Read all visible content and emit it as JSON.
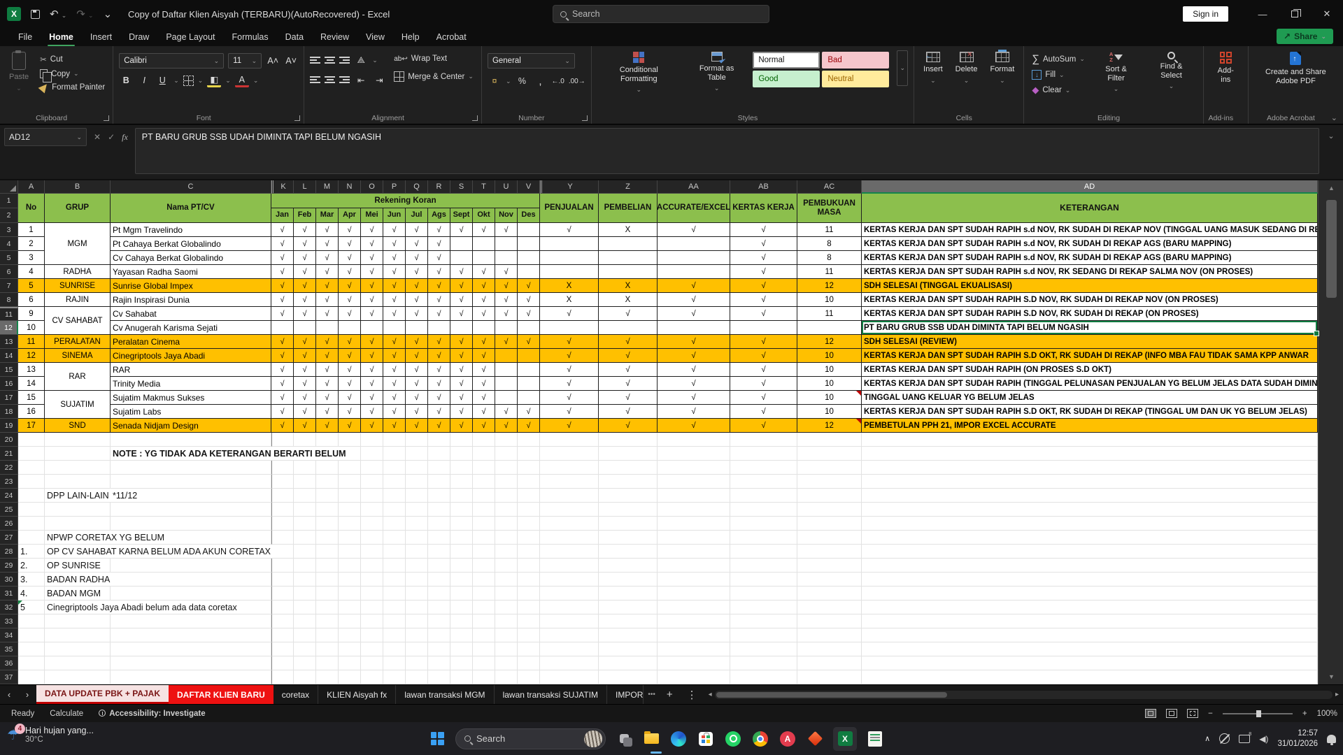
{
  "titlebar": {
    "title": "Copy of Daftar Klien Aisyah (TERBARU)(AutoRecovered)  -  Excel",
    "search_placeholder": "Search",
    "signin": "Sign in"
  },
  "menu": {
    "items": [
      "File",
      "Home",
      "Insert",
      "Draw",
      "Page Layout",
      "Formulas",
      "Data",
      "Review",
      "View",
      "Help",
      "Acrobat"
    ],
    "active": "Home",
    "share": "Share"
  },
  "ribbon": {
    "clipboard": {
      "paste": "Paste",
      "cut": "Cut",
      "copy": "Copy",
      "format_painter": "Format Painter",
      "label": "Clipboard"
    },
    "font": {
      "family": "Calibri",
      "size": "11",
      "bold": "B",
      "italic": "I",
      "underline": "U",
      "label": "Font"
    },
    "alignment": {
      "wrap": "Wrap Text",
      "merge": "Merge & Center",
      "label": "Alignment"
    },
    "number": {
      "format": "General",
      "percent": "%",
      "comma": ",",
      "label": "Number"
    },
    "styles": {
      "cf": "Conditional Formatting",
      "fat": "Format as Table",
      "normal": "Normal",
      "bad": "Bad",
      "good": "Good",
      "neutral": "Neutral",
      "label": "Styles"
    },
    "cells": {
      "insert": "Insert",
      "del": "Delete",
      "format": "Format",
      "label": "Cells"
    },
    "editing": {
      "autosum": "AutoSum",
      "fill": "Fill",
      "clear": "Clear",
      "sort": "Sort & Filter",
      "find": "Find & Select",
      "label": "Editing"
    },
    "addins": {
      "btn": "Add-ins",
      "label": "Add-ins"
    },
    "acrobat": {
      "btn": "Create and Share Adobe PDF",
      "label": "Adobe Acrobat"
    }
  },
  "formula_bar": {
    "cell_ref": "AD12",
    "formula": "PT BARU GRUB SSB UDAH DIMINTA TAPI  BELUM NGASIH"
  },
  "sheet": {
    "col_letters": [
      "A",
      "B",
      "C",
      "K",
      "L",
      "M",
      "N",
      "O",
      "P",
      "Q",
      "R",
      "S",
      "T",
      "U",
      "V",
      "Y",
      "Z",
      "AA",
      "AB",
      "AC",
      "AD"
    ],
    "selected_col": "AD",
    "selected_row": "12",
    "header": {
      "no": "No",
      "grup": "GRUP",
      "nama": "Nama PT/CV",
      "rekening": "Rekening Koran",
      "penjualan": "PENJUALAN",
      "pembelian": "PEMBELIAN",
      "accurate": "ACCURATE/EXCEL",
      "kertas": "KERTAS KERJA",
      "pembukuan": "PEMBUKUAN MASA",
      "keterangan": "KETERANGAN"
    },
    "months": [
      "Jan",
      "Feb",
      "Mar",
      "Apr",
      "Mei",
      "Jun",
      "Jul",
      "Ags",
      "Sept",
      "Okt",
      "Nov",
      "Des"
    ],
    "rows": [
      {
        "rn": "3",
        "no": "1",
        "grup": "MGM",
        "grup_span": 3,
        "nama": "Pt Mgm Travelindo",
        "m": [
          "√",
          "√",
          "√",
          "√",
          "√",
          "√",
          "√",
          "√",
          "√",
          "√",
          "√",
          ""
        ],
        "pj": "√",
        "pb": "X",
        "acc": "√",
        "kk": "√",
        "masa": "11",
        "ket": "KERTAS KERJA DAN SPT SUDAH RAPIH s.d NOV, RK SUDAH DI REKAP NOV (TINGGAL UANG MASUK SEDANG DI REKAP",
        "orange": false,
        "selected": false,
        "note": false
      },
      {
        "rn": "4",
        "no": "2",
        "grup": "",
        "grup_span": 0,
        "nama": "Pt Cahaya Berkat Globalindo",
        "m": [
          "√",
          "√",
          "√",
          "√",
          "√",
          "√",
          "√",
          "√",
          "",
          "",
          "",
          ""
        ],
        "pj": "",
        "pb": "",
        "acc": "",
        "kk": "√",
        "masa": "8",
        "ket": "KERTAS KERJA DAN SPT SUDAH RAPIH s.d NOV, RK SUDAH DI REKAP AGS (BARU  MAPPING)",
        "orange": false,
        "selected": false,
        "note": false
      },
      {
        "rn": "5",
        "no": "3",
        "grup": "",
        "grup_span": 0,
        "nama": "Cv Cahaya Berkat Globalindo",
        "m": [
          "√",
          "√",
          "√",
          "√",
          "√",
          "√",
          "√",
          "√",
          "",
          "",
          "",
          ""
        ],
        "pj": "",
        "pb": "",
        "acc": "",
        "kk": "√",
        "masa": "8",
        "ket": "KERTAS KERJA DAN SPT SUDAH RAPIH s.d NOV, RK SUDAH DI REKAP AGS (BARU MAPPING)",
        "orange": false,
        "selected": false,
        "note": false
      },
      {
        "rn": "6",
        "no": "4",
        "grup": "RADHA",
        "grup_span": 1,
        "nama": "Yayasan Radha Saomi",
        "m": [
          "√",
          "√",
          "√",
          "√",
          "√",
          "√",
          "√",
          "√",
          "√",
          "√",
          "√",
          ""
        ],
        "pj": "",
        "pb": "",
        "acc": "",
        "kk": "√",
        "masa": "11",
        "ket": "KERTAS KERJA DAN SPT SUDAH RAPIH s.d NOV, RK SEDANG DI REKAP SALMA NOV (ON PROSES)",
        "orange": false,
        "selected": false,
        "note": false
      },
      {
        "rn": "7",
        "no": "5",
        "grup": "SUNRISE",
        "grup_span": 1,
        "nama": "Sunrise Global Impex",
        "m": [
          "√",
          "√",
          "√",
          "√",
          "√",
          "√",
          "√",
          "√",
          "√",
          "√",
          "√",
          "√"
        ],
        "pj": "X",
        "pb": "X",
        "acc": "√",
        "kk": "√",
        "masa": "12",
        "ket": "SDH SELESAI (TINGGAL EKUALISASI)",
        "orange": true,
        "selected": false,
        "note": false
      },
      {
        "rn": "8",
        "no": "6",
        "grup": "RAJIN",
        "grup_span": 1,
        "nama": "Rajin Inspirasi Dunia",
        "m": [
          "√",
          "√",
          "√",
          "√",
          "√",
          "√",
          "√",
          "√",
          "√",
          "√",
          "√",
          "√"
        ],
        "pj": "X",
        "pb": "X",
        "acc": "√",
        "kk": "√",
        "masa": "10",
        "ket": "KERTAS KERJA DAN SPT SUDAH RAPIH S.D NOV, RK SUDAH DI REKAP NOV (ON PROSES)",
        "orange": false,
        "selected": false,
        "note": false
      },
      {
        "rn": "11",
        "no": "9",
        "grup": "CV SAHABAT",
        "grup_span": 2,
        "nama": "Cv Sahabat",
        "m": [
          "√",
          "√",
          "√",
          "√",
          "√",
          "√",
          "√",
          "√",
          "√",
          "√",
          "√",
          "√"
        ],
        "pj": "√",
        "pb": "√",
        "acc": "√",
        "kk": "√",
        "masa": "11",
        "ket": "KERTAS KERJA DAN SPT SUDAH RAPIH S.D NOV, RK SUDAH DI REKAP (ON PROSES)",
        "orange": false,
        "selected": false,
        "note": false
      },
      {
        "rn": "12",
        "no": "10",
        "grup": "",
        "grup_span": 0,
        "nama": "Cv Anugerah Karisma Sejati",
        "m": [
          "",
          "",
          "",
          "",
          "",
          "",
          "",
          "",
          "",
          "",
          "",
          ""
        ],
        "pj": "",
        "pb": "",
        "acc": "",
        "kk": "",
        "masa": "",
        "ket": "PT BARU GRUB SSB UDAH DIMINTA TAPI  BELUM NGASIH",
        "orange": false,
        "selected": true,
        "note": false
      },
      {
        "rn": "13",
        "no": "11",
        "grup": "PERALATAN",
        "grup_span": 1,
        "nama": "Peralatan Cinema",
        "m": [
          "√",
          "√",
          "√",
          "√",
          "√",
          "√",
          "√",
          "√",
          "√",
          "√",
          "√",
          "√"
        ],
        "pj": "√",
        "pb": "√",
        "acc": "√",
        "kk": "√",
        "masa": "12",
        "ket": "SDH SELESAI (REVIEW)",
        "orange": true,
        "selected": false,
        "note": false
      },
      {
        "rn": "14",
        "no": "12",
        "grup": "SINEMA",
        "grup_span": 1,
        "nama": "Cinegriptools Jaya Abadi",
        "m": [
          "√",
          "√",
          "√",
          "√",
          "√",
          "√",
          "√",
          "√",
          "√",
          "√",
          "",
          ""
        ],
        "pj": "√",
        "pb": "√",
        "acc": "√",
        "kk": "√",
        "masa": "10",
        "ket": "KERTAS KERJA DAN SPT SUDAH RAPIH S.D OKT, RK SUDAH DI REKAP (INFO  MBA FAU TIDAK SAMA KPP ANWAR",
        "orange": true,
        "selected": false,
        "note": false
      },
      {
        "rn": "15",
        "no": "13",
        "grup": "RAR",
        "grup_span": 2,
        "nama": "RAR",
        "m": [
          "√",
          "√",
          "√",
          "√",
          "√",
          "√",
          "√",
          "√",
          "√",
          "√",
          "",
          ""
        ],
        "pj": "√",
        "pb": "√",
        "acc": "√",
        "kk": "√",
        "masa": "10",
        "ket": "KERTAS KERJA DAN SPT SUDAH RAPIH (ON PROSES S.D OKT)",
        "orange": false,
        "selected": false,
        "note": false
      },
      {
        "rn": "16",
        "no": "14",
        "grup": "",
        "grup_span": 0,
        "nama": "Trinity Media",
        "m": [
          "√",
          "√",
          "√",
          "√",
          "√",
          "√",
          "√",
          "√",
          "√",
          "√",
          "",
          ""
        ],
        "pj": "√",
        "pb": "√",
        "acc": "√",
        "kk": "√",
        "masa": "10",
        "ket": "KERTAS KERJA DAN SPT SUDAH RAPIH (TINGGAL PELUNASAN PENJUALAN YG BELUM JELAS DATA SUDAH DIMIN",
        "orange": false,
        "selected": false,
        "note": false
      },
      {
        "rn": "17",
        "no": "15",
        "grup": "SUJATIM",
        "grup_span": 2,
        "nama": "Sujatim Makmus Sukses",
        "m": [
          "√",
          "√",
          "√",
          "√",
          "√",
          "√",
          "√",
          "√",
          "√",
          "√",
          "",
          ""
        ],
        "pj": "√",
        "pb": "√",
        "acc": "√",
        "kk": "√",
        "masa": "10",
        "ket": "TINGGAL UANG KELUAR YG BELUM JELAS",
        "orange": false,
        "selected": false,
        "note": true
      },
      {
        "rn": "18",
        "no": "16",
        "grup": "",
        "grup_span": 0,
        "nama": "Sujatim Labs",
        "m": [
          "√",
          "√",
          "√",
          "√",
          "√",
          "√",
          "√",
          "√",
          "√",
          "√",
          "√",
          "√"
        ],
        "pj": "√",
        "pb": "√",
        "acc": "√",
        "kk": "√",
        "masa": "10",
        "ket": "KERTAS KERJA DAN SPT SUDAH RAPIH S.D OKT, RK SUDAH DI REKAP (TINGGAL UM DAN UK YG BELUM JELAS)",
        "orange": false,
        "selected": false,
        "note": false
      },
      {
        "rn": "19",
        "no": "17",
        "grup": "SND",
        "grup_span": 1,
        "nama": "Senada Nidjam Design",
        "m": [
          "√",
          "√",
          "√",
          "√",
          "√",
          "√",
          "√",
          "√",
          "√",
          "√",
          "√",
          "√"
        ],
        "pj": "√",
        "pb": "√",
        "acc": "√",
        "kk": "√",
        "masa": "12",
        "ket": "PEMBETULAN PPH 21, IMPOR EXCEL ACCURATE",
        "orange": true,
        "selected": false,
        "note": true
      }
    ],
    "empty_rows": [
      "20",
      "21",
      "22",
      "23",
      "24",
      "25",
      "26",
      "27",
      "28",
      "29",
      "30",
      "31",
      "32",
      "33",
      "34",
      "35",
      "36",
      "37"
    ],
    "notes": [
      {
        "row": "21",
        "col": "C",
        "text": "NOTE : YG TIDAK ADA KETERANGAN BERARTI BELUM",
        "bold": true,
        "clip": false,
        "flag": false
      },
      {
        "row": "24",
        "col": "B",
        "text": "DPP LAIN-LAIN",
        "bold": false,
        "clip": true,
        "flag": false
      },
      {
        "row": "24",
        "col": "C",
        "text": "*11/12",
        "bold": false,
        "clip": false,
        "flag": false
      },
      {
        "row": "27",
        "col": "B",
        "text": "NPWP CORETAX YG BELUM",
        "bold": false,
        "clip": false,
        "flag": false
      },
      {
        "row": "28",
        "col": "A",
        "text": "1.",
        "bold": false,
        "clip": false,
        "flag": false
      },
      {
        "row": "28",
        "col": "B",
        "text": "OP CV SAHABAT KARNA BELUM ADA AKUN CORETAX",
        "bold": false,
        "clip": false,
        "flag": false
      },
      {
        "row": "29",
        "col": "A",
        "text": "2.",
        "bold": false,
        "clip": false,
        "flag": false
      },
      {
        "row": "29",
        "col": "B",
        "text": "OP SUNRISE",
        "bold": false,
        "clip": false,
        "flag": false
      },
      {
        "row": "30",
        "col": "A",
        "text": "3.",
        "bold": false,
        "clip": false,
        "flag": false
      },
      {
        "row": "30",
        "col": "B",
        "text": "BADAN RADHA",
        "bold": false,
        "clip": false,
        "flag": false
      },
      {
        "row": "31",
        "col": "A",
        "text": "4.",
        "bold": false,
        "clip": false,
        "flag": false
      },
      {
        "row": "31",
        "col": "B",
        "text": "BADAN MGM",
        "bold": false,
        "clip": false,
        "flag": false
      },
      {
        "row": "32",
        "col": "A",
        "text": "5",
        "bold": false,
        "clip": false,
        "flag": true
      },
      {
        "row": "32",
        "col": "B",
        "text": "Cinegriptools Jaya Abadi belum ada data coretax",
        "bold": false,
        "clip": false,
        "flag": false
      }
    ]
  },
  "sheet_tabs": {
    "items": [
      {
        "label": "DATA UPDATE PBK + PAJAK",
        "style": "active"
      },
      {
        "label": "DAFTAR KLIEN BARU",
        "style": "red"
      },
      {
        "label": "coretax",
        "style": "plain"
      },
      {
        "label": "KLIEN Aisyah fx",
        "style": "plain"
      },
      {
        "label": "lawan transaksi MGM",
        "style": "plain"
      },
      {
        "label": "lawan transaksi SUJATIM",
        "style": "plain"
      },
      {
        "label": "IMPOR",
        "style": "cut"
      }
    ],
    "overflow": "•••",
    "add": "+",
    "more": "⋮"
  },
  "status_bar": {
    "ready": "Ready",
    "calculate": "Calculate",
    "accessibility": "Accessibility: Investigate",
    "zoom": "100%"
  },
  "taskbar": {
    "weather_title": "Hari hujan yang...",
    "weather_temp": "30°C",
    "weather_badge": "4",
    "search": "Search",
    "time": "12:57",
    "date": "31/01/2026"
  },
  "colors": {
    "header_green": "#8CBF4D",
    "row_orange": "#FFC000",
    "selection_green": "#107C41",
    "active_tab_red": "#C00000",
    "tab_red_bg": "#EE1111"
  }
}
